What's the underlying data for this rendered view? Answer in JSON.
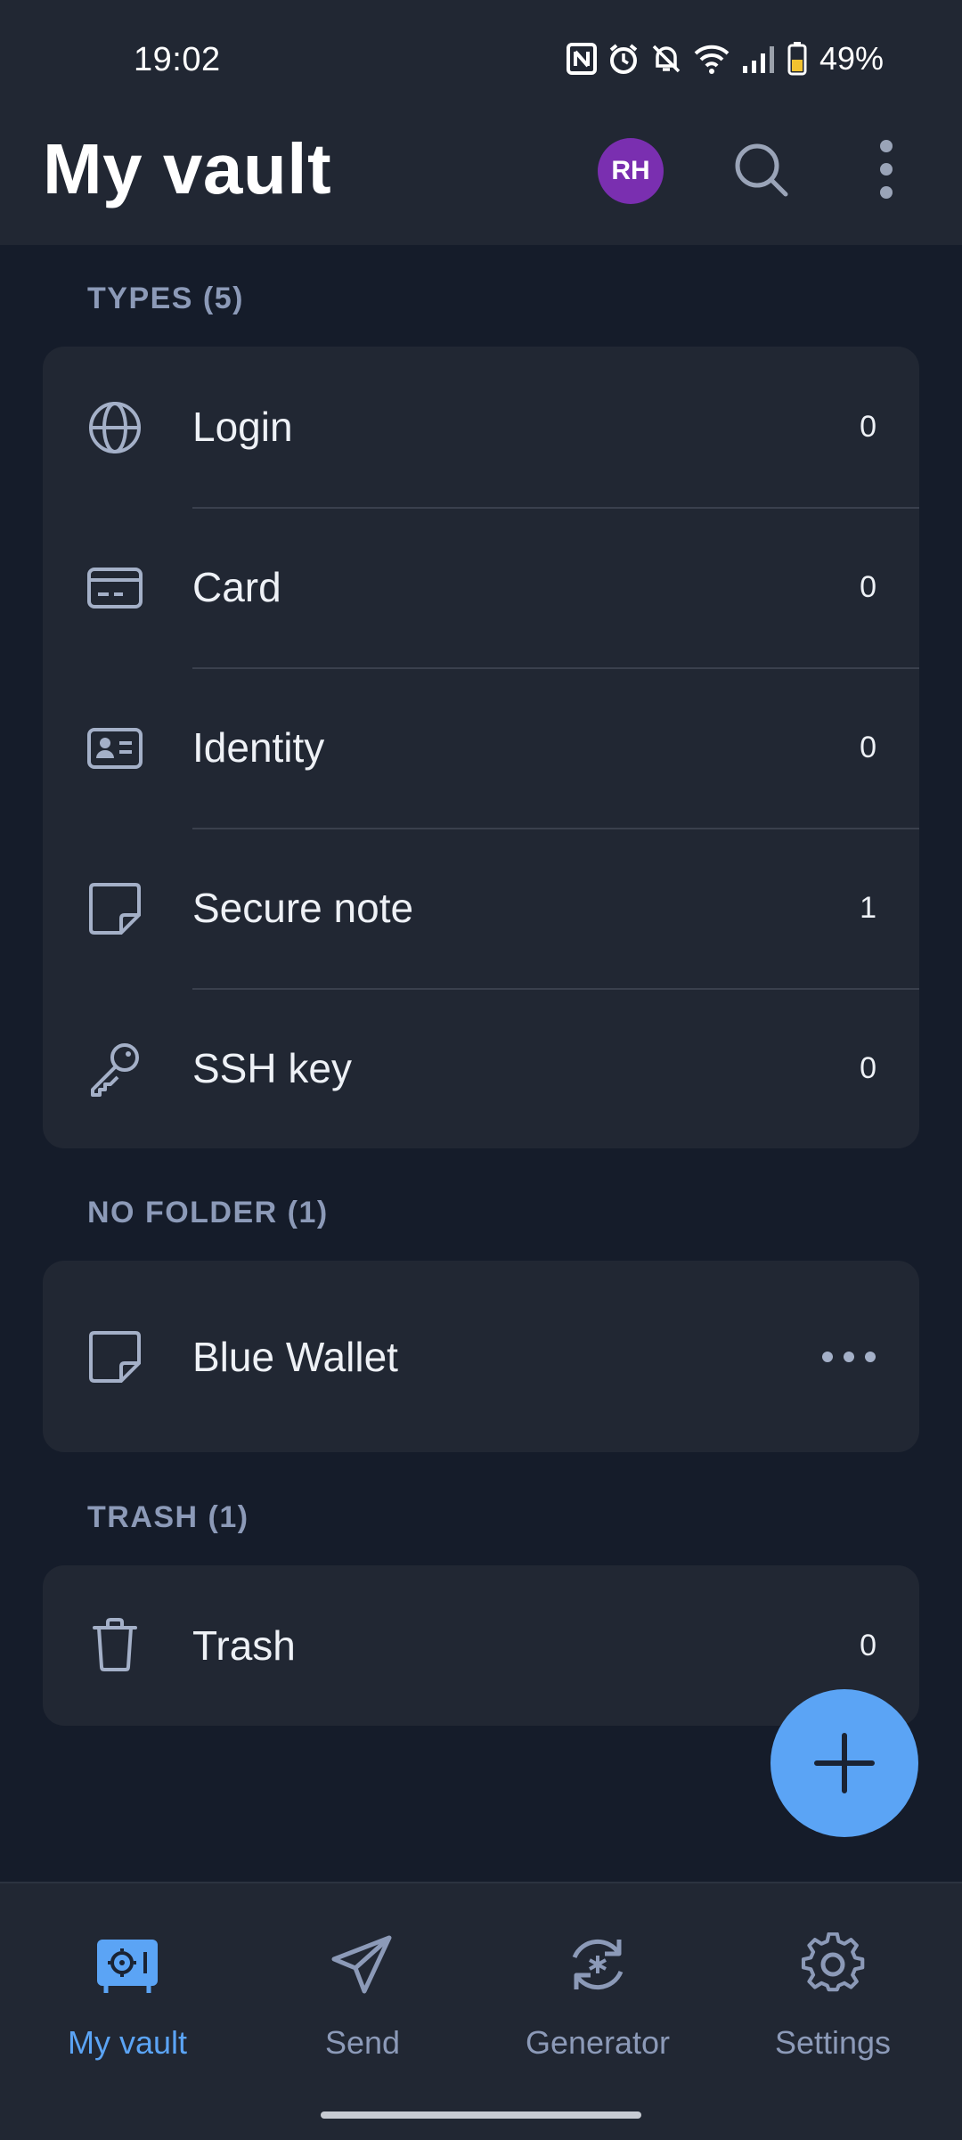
{
  "status_bar": {
    "time": "19:02",
    "battery": "49%",
    "icons": [
      "nfc-icon",
      "alarm-icon",
      "mute-icon",
      "wifi-icon",
      "signal-icon",
      "battery-icon"
    ]
  },
  "app_bar": {
    "title": "My vault",
    "avatar_initials": "RH",
    "avatar_color": "#7a2fb0"
  },
  "types_section": {
    "header": "TYPES (5)",
    "items": [
      {
        "label": "Login",
        "count": "0",
        "icon": "globe-icon"
      },
      {
        "label": "Card",
        "count": "0",
        "icon": "card-icon"
      },
      {
        "label": "Identity",
        "count": "0",
        "icon": "id-card-icon"
      },
      {
        "label": "Secure note",
        "count": "1",
        "icon": "note-icon"
      },
      {
        "label": "SSH key",
        "count": "0",
        "icon": "key-icon"
      }
    ]
  },
  "no_folder_section": {
    "header": "NO FOLDER (1)",
    "items": [
      {
        "label": "Blue Wallet",
        "icon": "note-icon",
        "action": "more-options-icon"
      }
    ]
  },
  "trash_section": {
    "header": "TRASH (1)",
    "items": [
      {
        "label": "Trash",
        "count": "0",
        "icon": "trash-icon"
      }
    ]
  },
  "bottom_nav": {
    "items": [
      {
        "label": "My vault",
        "icon": "vault-icon",
        "active": true
      },
      {
        "label": "Send",
        "icon": "send-icon",
        "active": false
      },
      {
        "label": "Generator",
        "icon": "generator-icon",
        "active": false
      },
      {
        "label": "Settings",
        "icon": "settings-icon",
        "active": false
      }
    ]
  },
  "colors": {
    "background": "#151c2a",
    "surface": "#212733",
    "accent": "#5ba4f5",
    "muted_text": "#8c9ab8"
  }
}
